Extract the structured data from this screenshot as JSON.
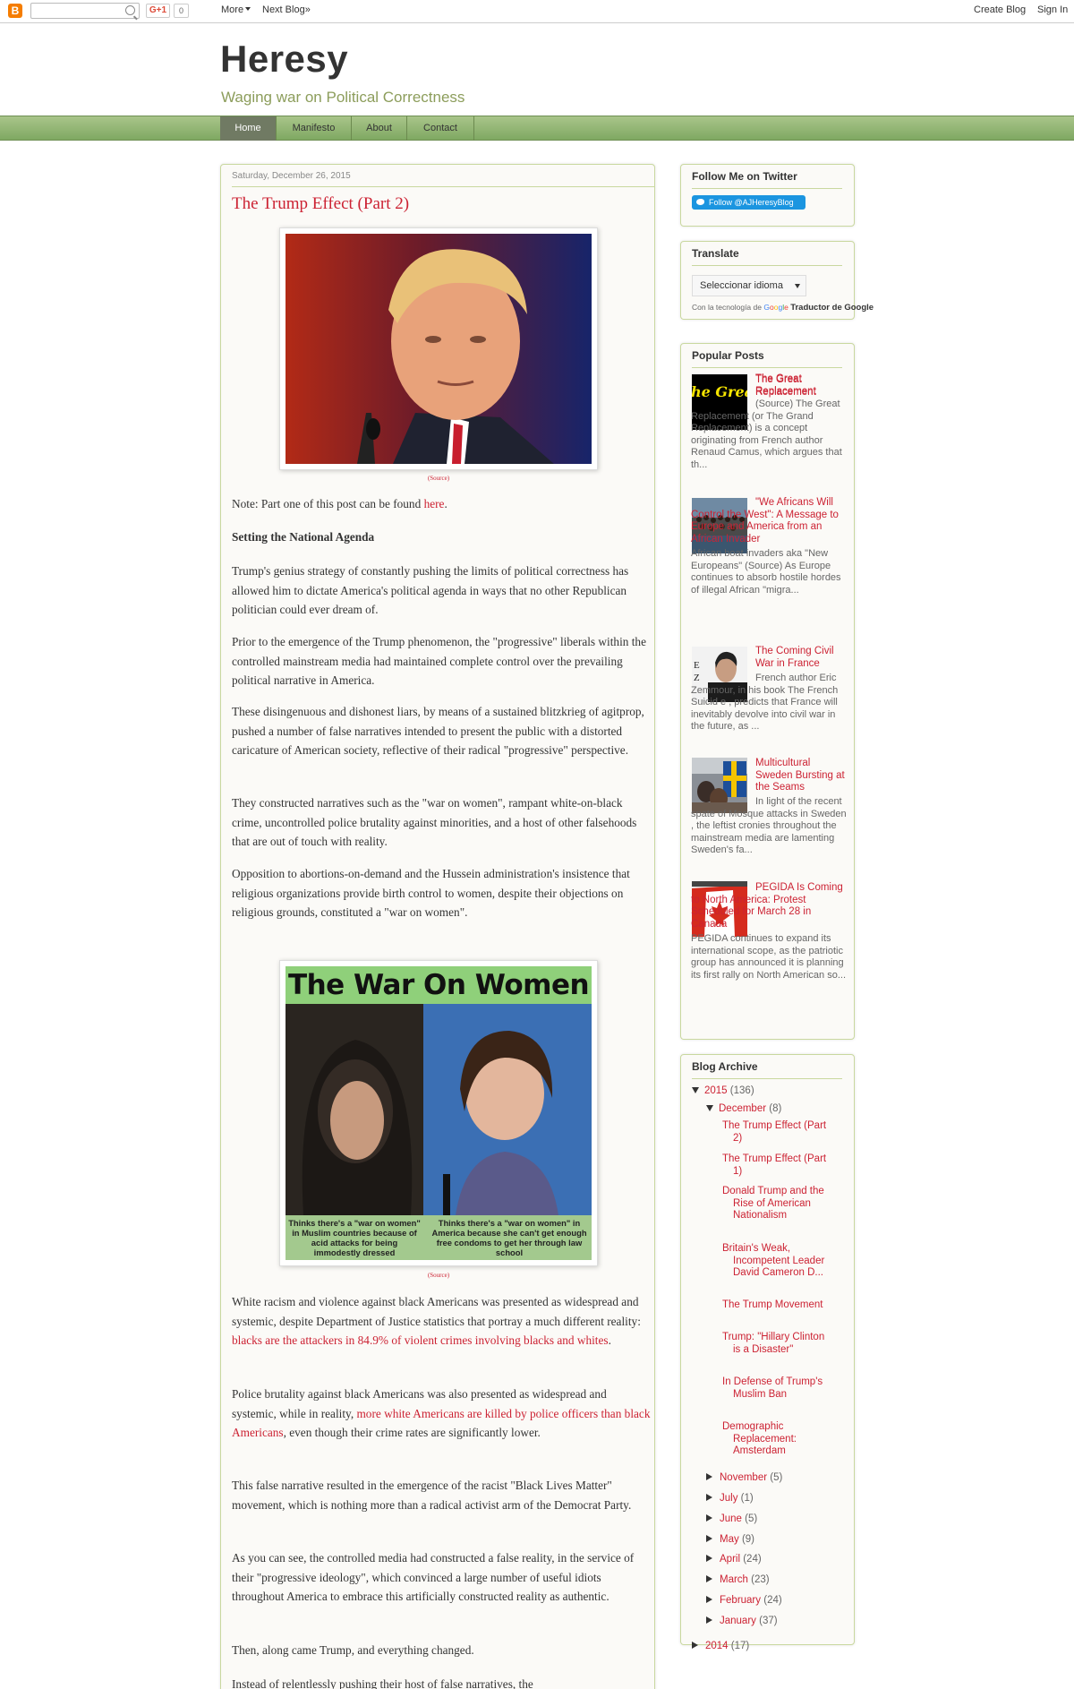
{
  "navbar": {
    "more_label": "More",
    "next_blog_label": "Next Blog»",
    "gplus_label": "G+1",
    "gplus_count": "0",
    "create_blog_label": "Create Blog",
    "sign_in_label": "Sign In"
  },
  "header": {
    "title": "Heresy",
    "description": "Waging war on Political Correctness"
  },
  "tabs": [
    "Home",
    "Manifesto",
    "About",
    "Contact"
  ],
  "post": {
    "date": "Saturday, December 26, 2015",
    "title": "The Trump Effect (Part 2)",
    "caption1": "(Source)",
    "caption2": "(Source)",
    "image2_heading": "The War On Women",
    "image2_left_caption": "Thinks there's a \"war on women\" in Muslim countries because of acid attacks for being immodestly dressed",
    "image2_right_caption": "Thinks there's a \"war on women\" in America because she can't get enough free condoms to get her through law school",
    "note_prefix": "Note: Part one of this post can be found ",
    "note_link": "here",
    "note_suffix": ".",
    "subheading": "Setting the National Agenda",
    "p1": "Trump's genius strategy of constantly pushing the limits of political correctness has allowed him to dictate America's political agenda in ways that no other Republican politician could ever dream of.",
    "p2": "Prior to the emergence of the Trump phenomenon, the \"progressive\" liberals within the controlled mainstream media had maintained complete control over the prevailing political narrative in America.",
    "p3": "These disingenuous and dishonest liars, by means of a sustained blitzkrieg of agitprop, pushed a number of false narratives intended to present the public with a distorted caricature of American society, reflective of their radical \"progressive\" perspective.",
    "p4": "They constructed narratives such as the \"war on women\", rampant white-on-black crime, uncontrolled police brutality against minorities, and a host of other falsehoods that are out of touch with reality.",
    "p5": "Opposition to abortions-on-demand and the Hussein administration's insistence that religious organizations provide birth control to women, despite their objections on religious grounds, constituted a \"war on women\".",
    "p6_prefix": "White racism and violence against black Americans was presented as widespread and systemic, despite Department of Justice statistics that portray a much different reality: ",
    "p6_link": "blacks are the attackers in 84.9% of violent crimes involving blacks and whites",
    "p6_suffix": ".",
    "p7_prefix": "Police brutality against black Americans was also presented as widespread and systemic, while in reality, ",
    "p7_link": "more white Americans are killed by police officers than black Americans",
    "p7_suffix": ", even though their crime rates are significantly lower.",
    "p8": "This false narrative resulted in the emergence of the racist \"Black Lives Matter\" movement, which is nothing more than a radical activist arm of the Democrat Party.",
    "p9": "As you can see, the controlled media had constructed a false reality, in the service of their \"progressive ideology\", which convinced a large number of useful idiots throughout America to embrace this artificially constructed reality as authentic.",
    "p10": "Then, along came Trump, and everything changed.",
    "p11": "Instead of relentlessly pushing their host of false narratives, the"
  },
  "sidebar": {
    "twitter": {
      "title": "Follow Me on Twitter",
      "button": "Follow @AJHeresyBlog"
    },
    "translate": {
      "title": "Translate",
      "select": "Seleccionar idioma",
      "powered_prefix": "Con la tecnología de",
      "powered_brand": "Traductor de Google"
    },
    "popular": {
      "title": "Popular Posts",
      "items": [
        {
          "title": "The Great Replacement",
          "snippet": "(Source) The Great Replacement (or The Grand Replacement) is a concept originating from French author Renaud Camus, which argues that th...",
          "thumb_text": "he Grea placem"
        },
        {
          "title": "\"We Africans Will Control the West\": A Message to Europe and America from an African Invader",
          "snippet": "African boat invaders aka \"New Europeans\" (Source) As Europe continues to absorb hostile hordes of illegal African \"migra..."
        },
        {
          "title": "The Coming Civil War in France",
          "snippet": "French author Eric Zemmour, in his book The French Suicid e , predicts that France will inevitably devolve into civil war in the future, as ..."
        },
        {
          "title": "Multicultural Sweden Bursting at the Seams",
          "snippet": "In light of the recent spate of Mosque attacks in Sweden , the leftist cronies throughout the mainstream media are lamenting Sweden's fa..."
        },
        {
          "title": "PEGIDA Is Coming to North America: Protest Scheduled for March 28 in Canada",
          "snippet": "PEGIDA continues to expand its international scope, as the patriotic group has announced it is planning its first rally on North American so..."
        }
      ]
    },
    "archive": {
      "title": "Blog Archive",
      "year_2015": "2015",
      "year_2015_count": "(136)",
      "december": "December",
      "december_count": "(8)",
      "december_posts": [
        "The Trump Effect (Part 2)",
        "The Trump Effect (Part 1)",
        "Donald Trump and the Rise of American Nationalism",
        "Britain's Weak, Incompetent Leader David Cameron D...",
        "The Trump Movement",
        "Trump: \"Hillary Clinton is a Disaster\"",
        "In Defense of Trump's Muslim Ban",
        "Demographic Replacement: Amsterdam"
      ],
      "months": [
        {
          "name": "November",
          "count": "(5)"
        },
        {
          "name": "July",
          "count": "(1)"
        },
        {
          "name": "June",
          "count": "(5)"
        },
        {
          "name": "May",
          "count": "(9)"
        },
        {
          "name": "April",
          "count": "(24)"
        },
        {
          "name": "March",
          "count": "(23)"
        },
        {
          "name": "February",
          "count": "(24)"
        },
        {
          "name": "January",
          "count": "(37)"
        }
      ],
      "year_2014": "2014",
      "year_2014_count": "(17)"
    }
  }
}
